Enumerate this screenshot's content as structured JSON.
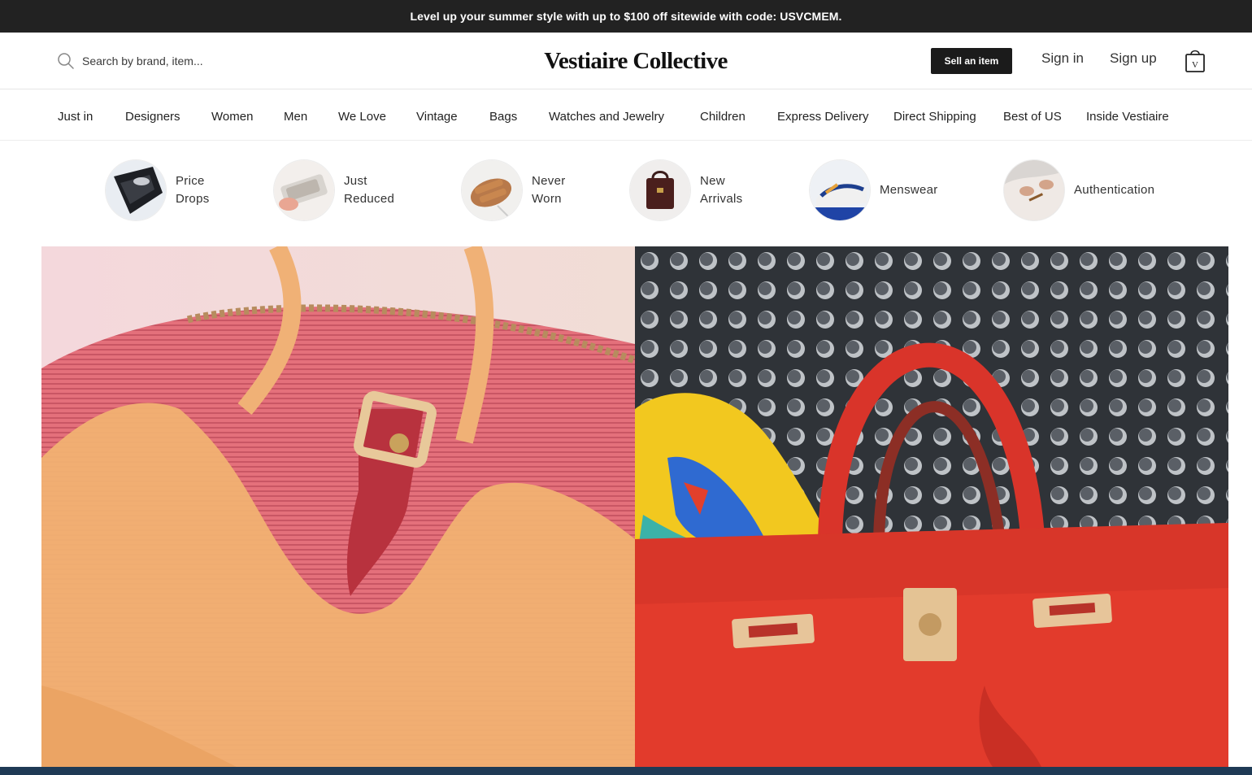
{
  "promo": {
    "text": "Level up your summer style with up to $100 off sitewide with code: USVCMEM."
  },
  "header": {
    "search_placeholder": "Search by brand, item...",
    "logo": "Vestiaire Collective",
    "sell_label": "Sell an item",
    "signin_label": "Sign in",
    "signup_label": "Sign up",
    "bag_letter": "V"
  },
  "nav": {
    "items": [
      "Just in",
      "Designers",
      "Women",
      "Men",
      "We Love",
      "Vintage",
      "Bags",
      "Watches and Jewelry",
      "Children",
      "Express Delivery",
      "Direct Shipping",
      "Best of US",
      "Inside Vestiaire"
    ]
  },
  "categories": [
    {
      "line1": "Price",
      "line2": "Drops"
    },
    {
      "line1": "Just",
      "line2": "Reduced"
    },
    {
      "line1": "Never",
      "line2": "Worn"
    },
    {
      "line1": "New",
      "line2": "Arrivals"
    },
    {
      "line1": "Menswear",
      "line2": ""
    },
    {
      "line1": "Authentication",
      "line2": ""
    }
  ],
  "colors": {
    "promo_bg": "#222222",
    "sell_button_bg": "#1b1b1b",
    "left_banner_main": "#e5747d",
    "right_banner_bag": "#e23b2c"
  },
  "icons": {
    "search": "search-icon",
    "bag": "shopping-bag-icon"
  }
}
